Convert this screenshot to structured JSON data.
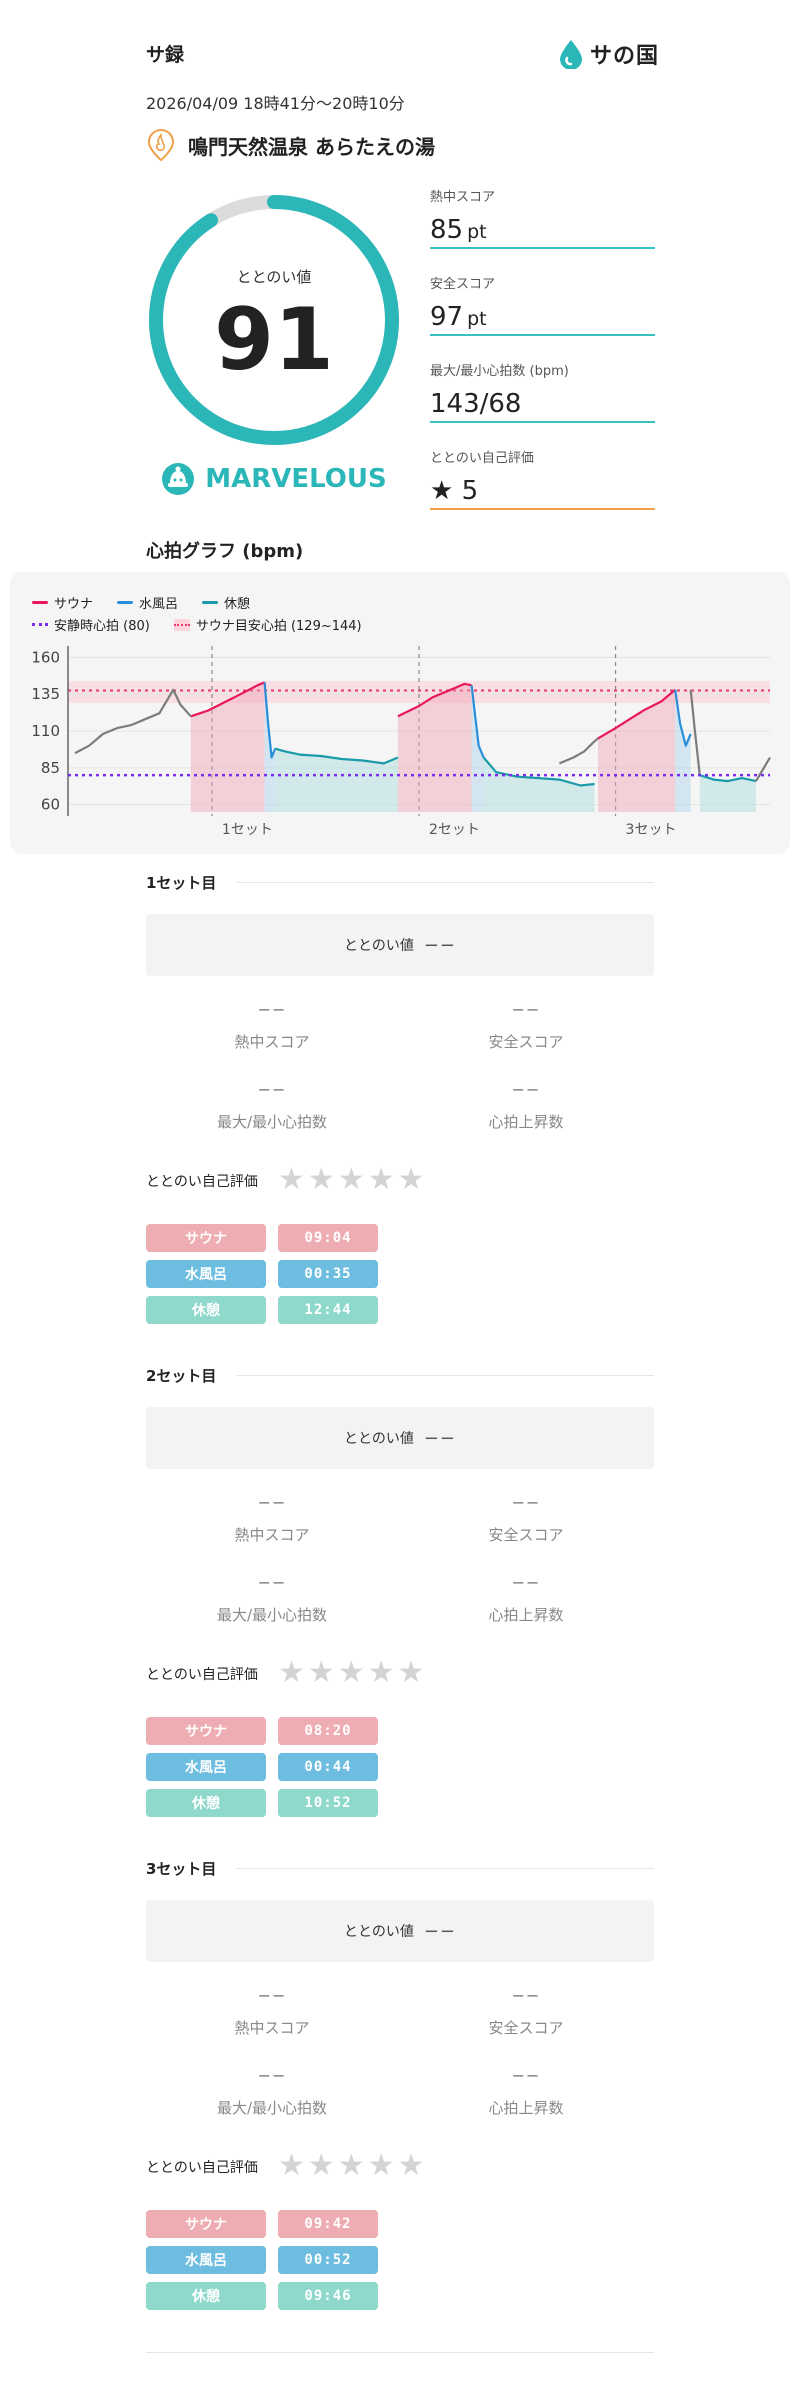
{
  "header": {
    "app_title": "サ録",
    "logo_text": "サの国",
    "date": "2026/04/09 18時41分〜20時10分",
    "facility_name": "鳴門天然温泉 あらたえの湯"
  },
  "summary": {
    "gauge_label": "ととのい値",
    "gauge_value": "91",
    "gauge_fraction": 0.91,
    "rank": "MARVELOUS",
    "scores": [
      {
        "label": "熱中スコア",
        "value": "85",
        "unit": "pt"
      },
      {
        "label": "安全スコア",
        "value": "97",
        "unit": "pt"
      },
      {
        "label": "最大/最小心拍数 (bpm)",
        "value": "143/68",
        "unit": ""
      },
      {
        "label": "ととのい自己評価",
        "value": "5",
        "unit": ""
      }
    ]
  },
  "colors": {
    "accent": "#2bb6b8",
    "sauna": "#e8185a",
    "water": "#2a8ed8",
    "rest": "#1a9aa8",
    "resting_line": "#7b2cf0",
    "target_band": "#fbd4dc",
    "self_eval": "#f0a048"
  },
  "chart_data": {
    "type": "line",
    "title": "心拍グラフ (bpm)",
    "legend": [
      "サウナ",
      "水風呂",
      "休憩",
      "安静時心拍 (80)",
      "サウナ目安心拍 (129~144)"
    ],
    "y_ticks": [
      160,
      135,
      110,
      85,
      60
    ],
    "ylim": [
      55,
      165
    ],
    "x_labels": [
      "1セット",
      "2セット",
      "3セット"
    ],
    "set_marks": [
      0.205,
      0.5,
      0.78
    ],
    "resting_hr": 80,
    "target_band": [
      129,
      144
    ],
    "x_range": [
      0,
      1
    ],
    "series": [
      {
        "name": "サウナ",
        "segments": [
          {
            "x": [
              0.175,
              0.2,
              0.225,
              0.25,
              0.27,
              0.28
            ],
            "y": [
              120,
              124,
              130,
              136,
              141,
              143
            ]
          },
          {
            "x": [
              0.47,
              0.5,
              0.52,
              0.545,
              0.565,
              0.575
            ],
            "y": [
              120,
              127,
              133,
              138,
              142,
              141
            ]
          },
          {
            "x": [
              0.755,
              0.78,
              0.8,
              0.82,
              0.845,
              0.865
            ],
            "y": [
              105,
              112,
              118,
              124,
              130,
              138
            ]
          }
        ]
      },
      {
        "name": "水風呂",
        "segments": [
          {
            "x": [
              0.28,
              0.285,
              0.29,
              0.295
            ],
            "y": [
              143,
              115,
              92,
              98
            ]
          },
          {
            "x": [
              0.575,
              0.58,
              0.585,
              0.592
            ],
            "y": [
              141,
              120,
              100,
              92
            ]
          },
          {
            "x": [
              0.865,
              0.872,
              0.88,
              0.887
            ],
            "y": [
              138,
              115,
              100,
              108
            ]
          }
        ]
      },
      {
        "name": "休憩",
        "segments": [
          {
            "x": [
              0.295,
              0.31,
              0.33,
              0.36,
              0.39,
              0.42,
              0.45,
              0.47
            ],
            "y": [
              98,
              96,
              94,
              93,
              91,
              90,
              88,
              92
            ]
          },
          {
            "x": [
              0.592,
              0.61,
              0.64,
              0.67,
              0.7,
              0.73,
              0.75
            ],
            "y": [
              92,
              82,
              79,
              78,
              77,
              73,
              74
            ]
          },
          {
            "x": [
              0.9,
              0.92,
              0.94,
              0.96,
              0.98
            ],
            "y": [
              80,
              77,
              76,
              78,
              76
            ]
          }
        ]
      },
      {
        "name": "その他",
        "segments": [
          {
            "x": [
              0.01,
              0.03,
              0.05,
              0.07,
              0.09,
              0.11,
              0.13,
              0.15,
              0.16,
              0.175
            ],
            "y": [
              95,
              100,
              108,
              112,
              114,
              118,
              122,
              138,
              128,
              120
            ]
          },
          {
            "x": [
              0.7,
              0.72,
              0.735,
              0.75,
              0.755
            ],
            "y": [
              88,
              92,
              96,
              103,
              105
            ]
          },
          {
            "x": [
              0.887,
              0.893,
              0.9
            ],
            "y": [
              138,
              110,
              80
            ]
          },
          {
            "x": [
              0.98,
              0.99,
              1.0
            ],
            "y": [
              76,
              84,
              92
            ]
          }
        ]
      }
    ]
  },
  "sets": [
    {
      "title": "1セット目",
      "totonoi_label": "ととのい値",
      "totonoi_value": "−−",
      "stats": [
        {
          "value": "−−",
          "label": "熱中スコア"
        },
        {
          "value": "−−",
          "label": "安全スコア"
        },
        {
          "value": "−−",
          "label": "最大/最小心拍数"
        },
        {
          "value": "−−",
          "label": "心拍上昇数"
        }
      ],
      "eval_label": "ととのい自己評価",
      "times": [
        {
          "label": "サウナ",
          "value": "09:04"
        },
        {
          "label": "水風呂",
          "value": "00:35"
        },
        {
          "label": "休憩",
          "value": "12:44"
        }
      ]
    },
    {
      "title": "2セット目",
      "totonoi_label": "ととのい値",
      "totonoi_value": "−−",
      "stats": [
        {
          "value": "−−",
          "label": "熱中スコア"
        },
        {
          "value": "−−",
          "label": "安全スコア"
        },
        {
          "value": "−−",
          "label": "最大/最小心拍数"
        },
        {
          "value": "−−",
          "label": "心拍上昇数"
        }
      ],
      "eval_label": "ととのい自己評価",
      "times": [
        {
          "label": "サウナ",
          "value": "08:20"
        },
        {
          "label": "水風呂",
          "value": "00:44"
        },
        {
          "label": "休憩",
          "value": "10:52"
        }
      ]
    },
    {
      "title": "3セット目",
      "totonoi_label": "ととのい値",
      "totonoi_value": "−−",
      "stats": [
        {
          "value": "−−",
          "label": "熱中スコア"
        },
        {
          "value": "−−",
          "label": "安全スコア"
        },
        {
          "value": "−−",
          "label": "最大/最小心拍数"
        },
        {
          "value": "−−",
          "label": "心拍上昇数"
        }
      ],
      "eval_label": "ととのい自己評価",
      "times": [
        {
          "label": "サウナ",
          "value": "09:42"
        },
        {
          "label": "水風呂",
          "value": "00:52"
        },
        {
          "label": "休憩",
          "value": "09:46"
        }
      ]
    }
  ]
}
